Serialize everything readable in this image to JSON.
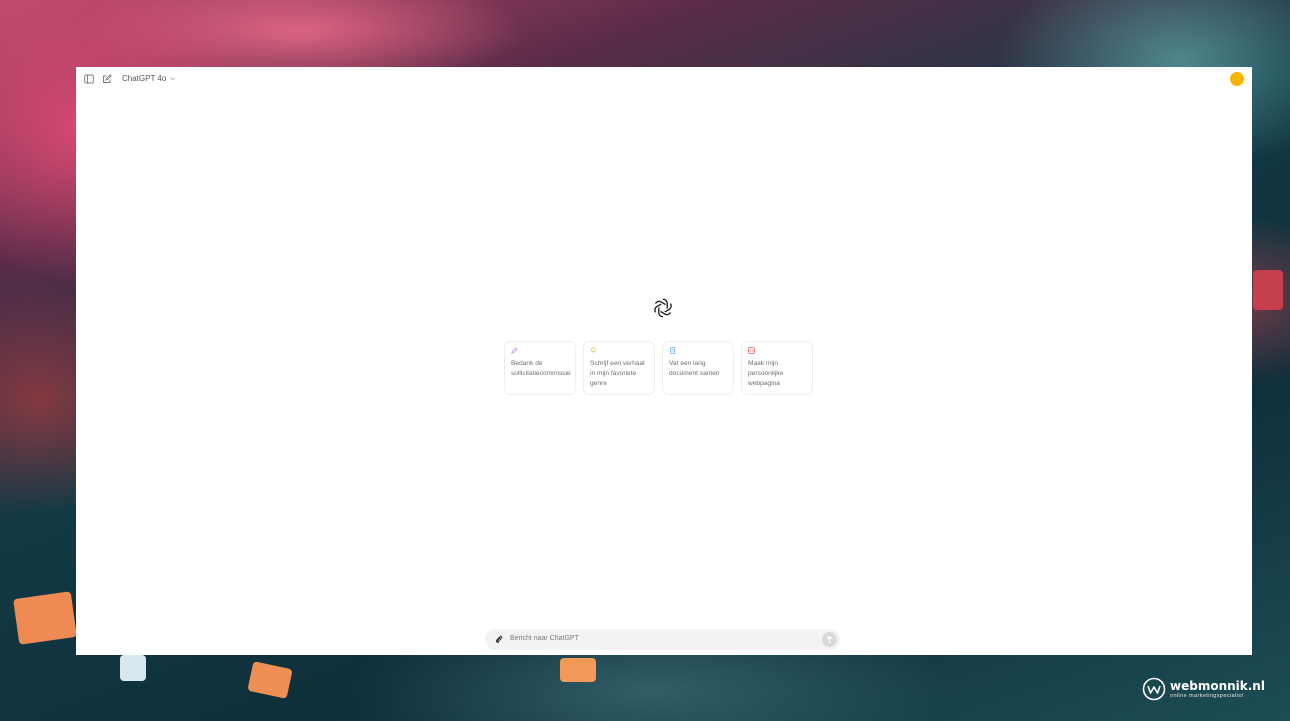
{
  "header": {
    "model_label": "ChatGPT 4o",
    "sidebar_icon": "sidebar-toggle-icon",
    "new_chat_icon": "new-chat-icon",
    "model_chevron_icon": "chevron-down-icon",
    "avatar_color": "#f6b500"
  },
  "main": {
    "logo_icon": "openai-logo-icon",
    "suggestions": [
      {
        "label": "Bedank de sollicitatiecommissie",
        "icon": "pen-icon",
        "icon_color": "#c09ad6"
      },
      {
        "label": "Schrijf een verhaal in mijn favoriete genre",
        "icon": "lightbulb-icon",
        "icon_color": "#e7c341"
      },
      {
        "label": "Vat een lang document samen",
        "icon": "document-icon",
        "icon_color": "#6ea6e8"
      },
      {
        "label": "Maak mijn persoonlijke webpagina",
        "icon": "code-icon",
        "icon_color": "#e06262"
      }
    ]
  },
  "composer": {
    "placeholder": "Bericht naar ChatGPT",
    "attach_icon": "paperclip-icon",
    "send_icon": "send-arrow-icon"
  },
  "watermark": {
    "name": "webmonnik.nl",
    "tagline": "online marketingspecialist",
    "logo_icon": "webmonnik-logo-icon"
  }
}
